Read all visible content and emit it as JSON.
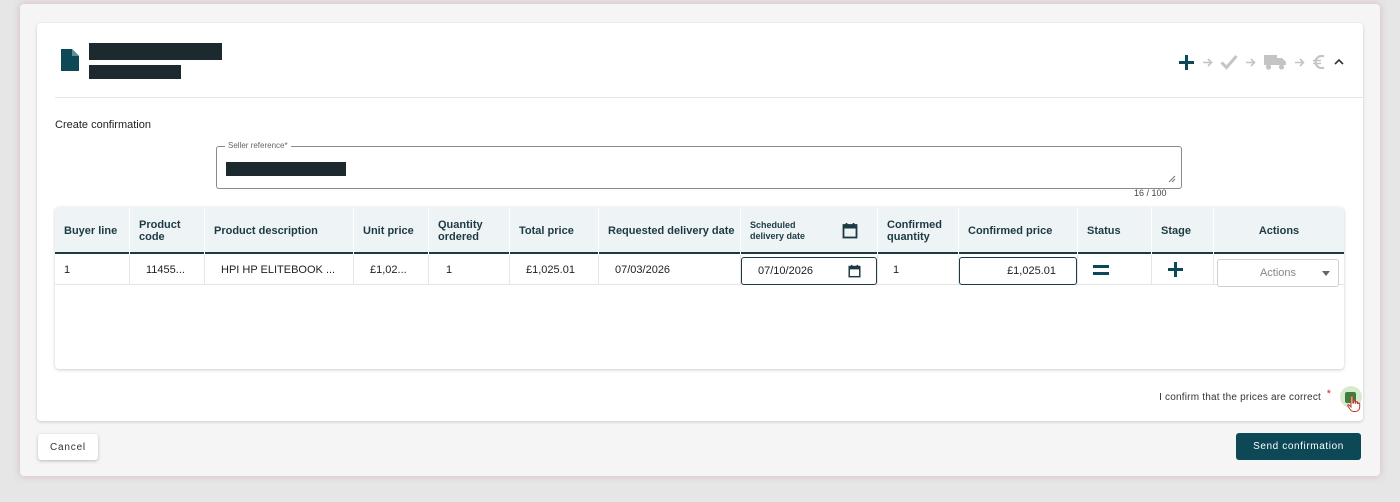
{
  "section_title": "Create confirmation",
  "seller_reference": {
    "label": "Seller reference*",
    "counter": "16 / 100"
  },
  "table": {
    "headers": [
      "Buyer line",
      "Product code",
      "Product description",
      "Unit price",
      "Quantity ordered",
      "Total price",
      "Requested delivery date",
      "Scheduled delivery date",
      "Confirmed quantity",
      "Confirmed price",
      "Status",
      "Stage",
      "Actions"
    ],
    "row": {
      "buyer_line": "1",
      "product_code": "11455...",
      "product_description": "HPI HP ELITEBOOK ...",
      "unit_price": "£1,02...",
      "quantity_ordered": "1",
      "total_price": "£1,025.01",
      "requested_delivery_date": "07/03/2026",
      "scheduled_delivery_date": "07/10/2026",
      "confirmed_quantity": "1",
      "confirmed_price": "£1,025.01",
      "actions_placeholder": "Actions"
    }
  },
  "confirm_prices": {
    "label": "I confirm that the prices are correct",
    "required_marker": "*",
    "checked": true
  },
  "buttons": {
    "cancel": "Cancel",
    "send": "Send confirmation"
  },
  "progress_steps": [
    "plus-icon",
    "check-icon",
    "truck-icon",
    "euro-icon"
  ],
  "colors": {
    "primary": "#0d4856",
    "header_text": "#1c3a44",
    "inactive_step": "#c4c4c4",
    "checkbox": "#3e7d3e"
  }
}
